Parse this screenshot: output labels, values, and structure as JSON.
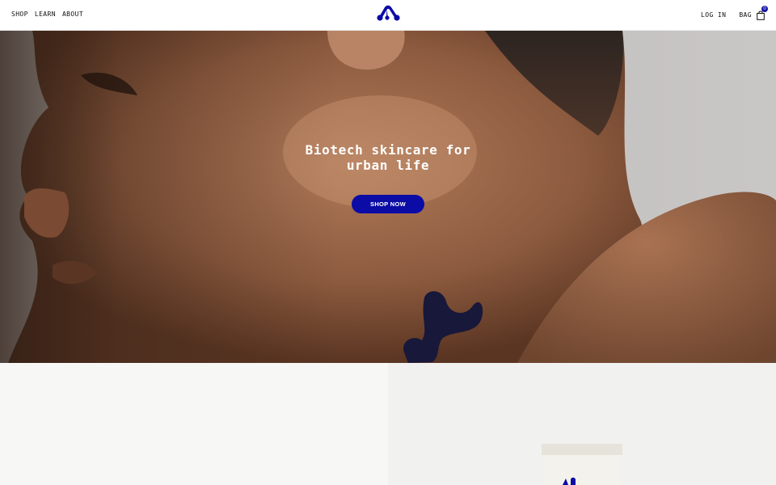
{
  "nav": {
    "left": [
      "SHOP",
      "LEARN",
      "ABOUT"
    ],
    "login": "LOG IN",
    "bag_label": "BAG",
    "bag_count": "0"
  },
  "logo_icon": "molecule-logo-icon",
  "hero": {
    "title": "Biotech skincare for\nurban life",
    "cta": "SHOP NOW"
  },
  "colors": {
    "accent": "#0b0ba6",
    "header_bg": "#ffffff",
    "section_bg": "#f7f7f5"
  },
  "icons": [
    "molecule-logo-icon",
    "shopping-bag-icon"
  ]
}
